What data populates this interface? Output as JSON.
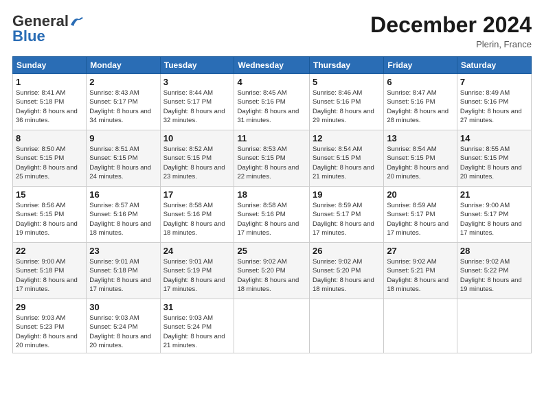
{
  "header": {
    "logo_general": "General",
    "logo_blue": "Blue",
    "month_title": "December 2024",
    "location": "Plerin, France"
  },
  "days_of_week": [
    "Sunday",
    "Monday",
    "Tuesday",
    "Wednesday",
    "Thursday",
    "Friday",
    "Saturday"
  ],
  "weeks": [
    [
      {
        "day": "1",
        "sunrise": "8:41 AM",
        "sunset": "5:18 PM",
        "daylight": "8 hours and 36 minutes."
      },
      {
        "day": "2",
        "sunrise": "8:43 AM",
        "sunset": "5:17 PM",
        "daylight": "8 hours and 34 minutes."
      },
      {
        "day": "3",
        "sunrise": "8:44 AM",
        "sunset": "5:17 PM",
        "daylight": "8 hours and 32 minutes."
      },
      {
        "day": "4",
        "sunrise": "8:45 AM",
        "sunset": "5:16 PM",
        "daylight": "8 hours and 31 minutes."
      },
      {
        "day": "5",
        "sunrise": "8:46 AM",
        "sunset": "5:16 PM",
        "daylight": "8 hours and 29 minutes."
      },
      {
        "day": "6",
        "sunrise": "8:47 AM",
        "sunset": "5:16 PM",
        "daylight": "8 hours and 28 minutes."
      },
      {
        "day": "7",
        "sunrise": "8:49 AM",
        "sunset": "5:16 PM",
        "daylight": "8 hours and 27 minutes."
      }
    ],
    [
      {
        "day": "8",
        "sunrise": "8:50 AM",
        "sunset": "5:15 PM",
        "daylight": "8 hours and 25 minutes."
      },
      {
        "day": "9",
        "sunrise": "8:51 AM",
        "sunset": "5:15 PM",
        "daylight": "8 hours and 24 minutes."
      },
      {
        "day": "10",
        "sunrise": "8:52 AM",
        "sunset": "5:15 PM",
        "daylight": "8 hours and 23 minutes."
      },
      {
        "day": "11",
        "sunrise": "8:53 AM",
        "sunset": "5:15 PM",
        "daylight": "8 hours and 22 minutes."
      },
      {
        "day": "12",
        "sunrise": "8:54 AM",
        "sunset": "5:15 PM",
        "daylight": "8 hours and 21 minutes."
      },
      {
        "day": "13",
        "sunrise": "8:54 AM",
        "sunset": "5:15 PM",
        "daylight": "8 hours and 20 minutes."
      },
      {
        "day": "14",
        "sunrise": "8:55 AM",
        "sunset": "5:15 PM",
        "daylight": "8 hours and 20 minutes."
      }
    ],
    [
      {
        "day": "15",
        "sunrise": "8:56 AM",
        "sunset": "5:15 PM",
        "daylight": "8 hours and 19 minutes."
      },
      {
        "day": "16",
        "sunrise": "8:57 AM",
        "sunset": "5:16 PM",
        "daylight": "8 hours and 18 minutes."
      },
      {
        "day": "17",
        "sunrise": "8:58 AM",
        "sunset": "5:16 PM",
        "daylight": "8 hours and 18 minutes."
      },
      {
        "day": "18",
        "sunrise": "8:58 AM",
        "sunset": "5:16 PM",
        "daylight": "8 hours and 17 minutes."
      },
      {
        "day": "19",
        "sunrise": "8:59 AM",
        "sunset": "5:17 PM",
        "daylight": "8 hours and 17 minutes."
      },
      {
        "day": "20",
        "sunrise": "8:59 AM",
        "sunset": "5:17 PM",
        "daylight": "8 hours and 17 minutes."
      },
      {
        "day": "21",
        "sunrise": "9:00 AM",
        "sunset": "5:17 PM",
        "daylight": "8 hours and 17 minutes."
      }
    ],
    [
      {
        "day": "22",
        "sunrise": "9:00 AM",
        "sunset": "5:18 PM",
        "daylight": "8 hours and 17 minutes."
      },
      {
        "day": "23",
        "sunrise": "9:01 AM",
        "sunset": "5:18 PM",
        "daylight": "8 hours and 17 minutes."
      },
      {
        "day": "24",
        "sunrise": "9:01 AM",
        "sunset": "5:19 PM",
        "daylight": "8 hours and 17 minutes."
      },
      {
        "day": "25",
        "sunrise": "9:02 AM",
        "sunset": "5:20 PM",
        "daylight": "8 hours and 18 minutes."
      },
      {
        "day": "26",
        "sunrise": "9:02 AM",
        "sunset": "5:20 PM",
        "daylight": "8 hours and 18 minutes."
      },
      {
        "day": "27",
        "sunrise": "9:02 AM",
        "sunset": "5:21 PM",
        "daylight": "8 hours and 18 minutes."
      },
      {
        "day": "28",
        "sunrise": "9:02 AM",
        "sunset": "5:22 PM",
        "daylight": "8 hours and 19 minutes."
      }
    ],
    [
      {
        "day": "29",
        "sunrise": "9:03 AM",
        "sunset": "5:23 PM",
        "daylight": "8 hours and 20 minutes."
      },
      {
        "day": "30",
        "sunrise": "9:03 AM",
        "sunset": "5:24 PM",
        "daylight": "8 hours and 20 minutes."
      },
      {
        "day": "31",
        "sunrise": "9:03 AM",
        "sunset": "5:24 PM",
        "daylight": "8 hours and 21 minutes."
      },
      null,
      null,
      null,
      null
    ]
  ]
}
